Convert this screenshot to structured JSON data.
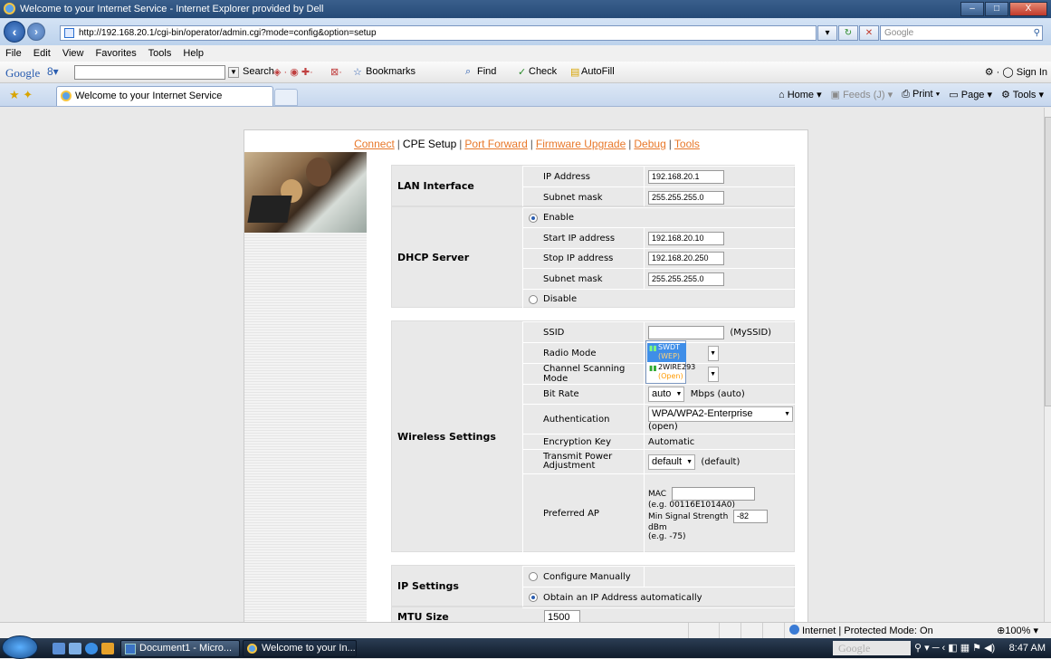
{
  "window": {
    "title": "Welcome to your Internet Service - Internet Explorer provided by Dell",
    "controls": [
      "–",
      "□",
      "X"
    ]
  },
  "address_bar": {
    "url": "http://192.168.20.1/cgi-bin/operator/admin.cgi?mode=config&option=setup",
    "search_placeholder": "Google"
  },
  "menu": [
    "File",
    "Edit",
    "View",
    "Favorites",
    "Tools",
    "Help"
  ],
  "google_toolbar": {
    "logo": "Google",
    "search_label": "Search",
    "bookmarks_label": "Bookmarks",
    "find_label": "Find",
    "check_label": "Check",
    "autofill_label": "AutoFill",
    "signin_label": "Sign In"
  },
  "tabs": [
    {
      "label": "Welcome to your Internet Service"
    }
  ],
  "commandbar": {
    "home": "Home",
    "feeds": "Feeds (J)",
    "print": "Print",
    "page": "Page",
    "tools": "Tools"
  },
  "page": {
    "nav": {
      "connect": "Connect",
      "cpe_setup": "CPE Setup",
      "port_forward": "Port Forward",
      "firmware_upgrade": "Firmware Upgrade",
      "debug": "Debug",
      "tools": "Tools",
      "sep": "|"
    },
    "lan": {
      "label": "LAN Interface",
      "ip_label": "IP Address",
      "ip_value": "192.168.20.1",
      "mask_label": "Subnet mask",
      "mask_value": "255.255.255.0"
    },
    "dhcp": {
      "label": "DHCP Server",
      "enable_label": "Enable",
      "start_label": "Start IP address",
      "start_value": "192.168.20.10",
      "stop_label": "Stop IP address",
      "stop_value": "192.168.20.250",
      "mask_label": "Subnet mask",
      "mask_value": "255.255.255.0",
      "disable_label": "Disable"
    },
    "wireless": {
      "label": "Wireless Settings",
      "ssid_label": "SSID",
      "ssid_value": "",
      "ssid_hint": "(MySSID)",
      "ssid_options": [
        {
          "name": "SWDT",
          "security": "(WEP)"
        },
        {
          "name": "2WIRE293",
          "security": "(Open)"
        }
      ],
      "radio_label": "Radio Mode",
      "channel_label": "Channel Scanning Mode",
      "bitrate_label": "Bit Rate",
      "bitrate_value": "auto",
      "bitrate_hint": "Mbps (auto)",
      "auth_label": "Authentication",
      "auth_value": "WPA/WPA2-Enterprise",
      "auth_hint": "(open)",
      "enc_label": "Encryption Key",
      "enc_value": "Automatic",
      "txpower_label": "Transmit Power Adjustment",
      "txpower_value": "default",
      "txpower_hint": "(default)",
      "pref_label": "Preferred AP",
      "mac_label": "MAC",
      "mac_value": "",
      "mac_hint": "(e.g. 00116E1014A0)",
      "minsig_label": "Min Signal Strength",
      "minsig_value": "-82",
      "minsig_unit": "dBm",
      "minsig_hint": "(e.g. -75)"
    },
    "ip_settings": {
      "label": "IP Settings",
      "manual_label": "Configure Manually",
      "auto_label": "Obtain an IP Address automatically"
    },
    "mtu": {
      "label": "MTU Size",
      "value": "1500"
    }
  },
  "statusbar": {
    "zone": "Internet | Protected Mode: On",
    "zoom": "100%"
  },
  "taskbar": {
    "buttons": [
      "Document1 - Micro...",
      "Welcome to your In..."
    ],
    "tray_search": "Google",
    "clock": "8:47 AM"
  },
  "colors": {
    "link": "#e8782a",
    "titlebar": "#264a77",
    "selection": "#3f8ee8",
    "security": "#ff9a00"
  }
}
